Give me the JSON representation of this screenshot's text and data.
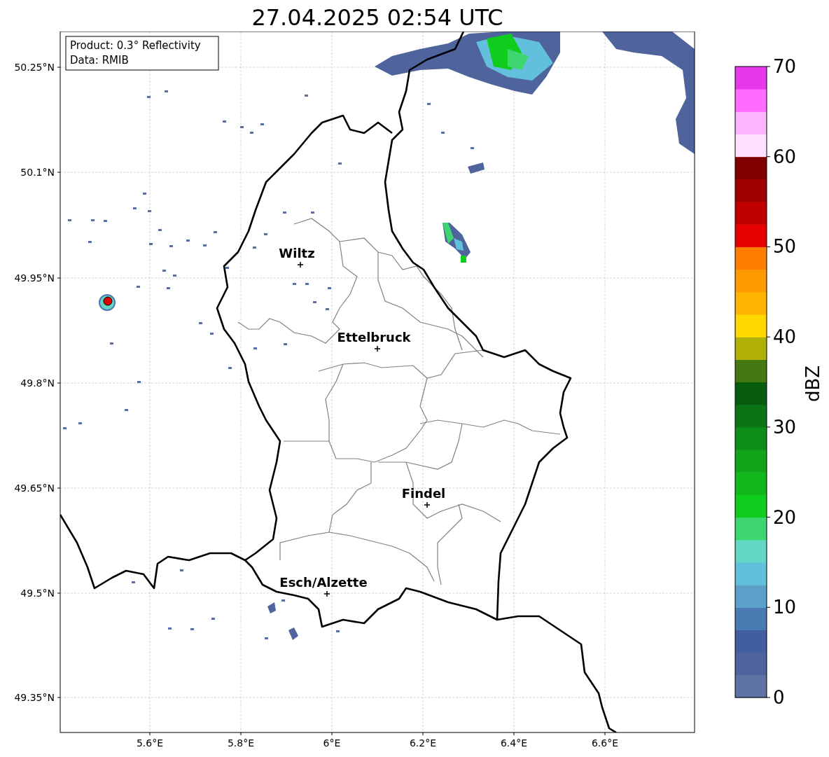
{
  "title": "27.04.2025 02:54 UTC",
  "info_box": [
    "Product: 0.3° Reflectivity",
    "Data: RMIB"
  ],
  "map": {
    "lat_labels": [
      "50.25°N",
      "50.1°N",
      "49.95°N",
      "49.8°N",
      "49.65°N",
      "49.5°N",
      "49.35°N"
    ],
    "lon_labels": [
      "5.6°E",
      "5.8°E",
      "6°E",
      "6.2°E",
      "6.4°E",
      "6.6°E"
    ],
    "cities": [
      {
        "name": "Wiltz"
      },
      {
        "name": "Ettelbruck"
      },
      {
        "name": "Findel"
      },
      {
        "name": "Esch/Alzette"
      }
    ]
  },
  "colorbar": {
    "label": "dBZ",
    "ticks": [
      "70",
      "60",
      "50",
      "40",
      "30",
      "20",
      "10",
      "0"
    ],
    "bins": [
      {
        "color": "#5f72a4"
      },
      {
        "color": "#4f639c"
      },
      {
        "color": "#435e9f"
      },
      {
        "color": "#4a7ab2"
      },
      {
        "color": "#5aa0c8"
      },
      {
        "color": "#62c0dc"
      },
      {
        "color": "#62d8c4"
      },
      {
        "color": "#3ed670"
      },
      {
        "color": "#10cc1c"
      },
      {
        "color": "#10b81a"
      },
      {
        "color": "#10a418"
      },
      {
        "color": "#0e8c18"
      },
      {
        "color": "#0b7414"
      },
      {
        "color": "#085c10"
      },
      {
        "color": "#457810"
      },
      {
        "color": "#b0b008"
      },
      {
        "color": "#ffd800"
      },
      {
        "color": "#ffb400"
      },
      {
        "color": "#ff9a00"
      },
      {
        "color": "#ff7e00"
      },
      {
        "color": "#e60000"
      },
      {
        "color": "#c00000"
      },
      {
        "color": "#a00000"
      },
      {
        "color": "#800000"
      },
      {
        "color": "#ffe0ff"
      },
      {
        "color": "#ffb4ff"
      },
      {
        "color": "#ff6cff"
      },
      {
        "color": "#e838ec"
      }
    ]
  }
}
